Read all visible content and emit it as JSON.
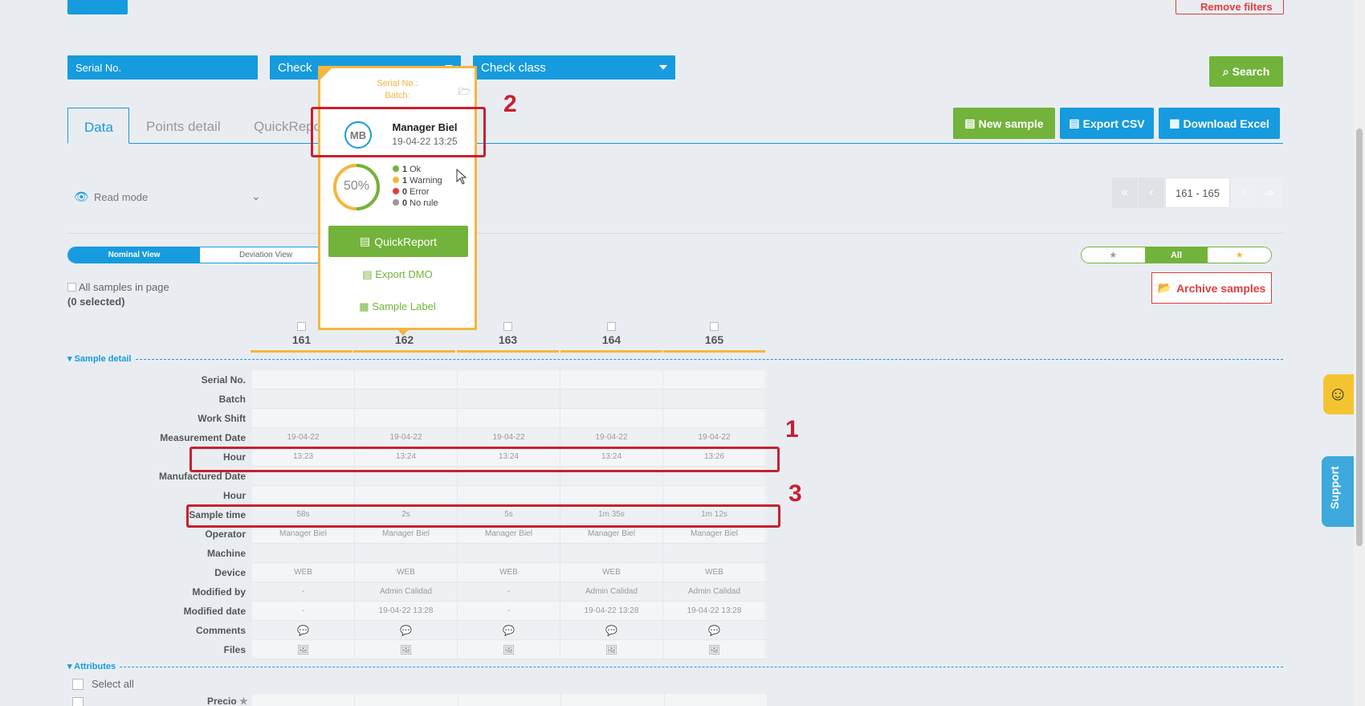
{
  "top": {
    "remove_filters": "Remove filters"
  },
  "filters": {
    "serial_no": "Serial No.",
    "check": "Check",
    "check_class": "Check class",
    "search": "Search"
  },
  "tabs": [
    {
      "label": "Data"
    },
    {
      "label": "Points detail"
    },
    {
      "label": "QuickRepo"
    }
  ],
  "actions": {
    "new_sample": "New sample",
    "export_csv": "Export CSV",
    "download_excel": "Download Excel"
  },
  "read_mode": "Read mode",
  "pager": {
    "range": "161 - 165"
  },
  "views": {
    "nominal": "Nominal View",
    "deviation": "Deviation View"
  },
  "star_filter": {
    "all": "All"
  },
  "all_samples": "All samples in page",
  "selected": "(0 selected)",
  "archive": "Archive samples",
  "columns": [
    "161",
    "162",
    "163",
    "164",
    "165"
  ],
  "sections": {
    "sample_detail": "Sample detail",
    "attributes": "Attributes"
  },
  "rows": [
    {
      "label": "Serial No.",
      "cells": [
        "",
        "",
        "",
        "",
        ""
      ]
    },
    {
      "label": "Batch",
      "cells": [
        "",
        "",
        "",
        "",
        ""
      ]
    },
    {
      "label": "Work Shift",
      "cells": [
        "",
        "",
        "",
        "",
        ""
      ]
    },
    {
      "label": "Measurement Date",
      "cells": [
        "19-04-22",
        "19-04-22",
        "19-04-22",
        "19-04-22",
        "19-04-22"
      ]
    },
    {
      "label": "Hour",
      "cells": [
        "13:23",
        "13:24",
        "13:24",
        "13:24",
        "13:26"
      ]
    },
    {
      "label": "Manufactured Date",
      "cells": [
        "",
        "",
        "",
        "",
        ""
      ]
    },
    {
      "label": "Hour",
      "cells": [
        "",
        "",
        "",
        "",
        ""
      ]
    },
    {
      "label": "Sample time",
      "cells": [
        "58s",
        "2s",
        "5s",
        "1m 35s",
        "1m 12s"
      ]
    },
    {
      "label": "Operator",
      "cells": [
        "Manager Biel",
        "Manager Biel",
        "Manager Biel",
        "Manager Biel",
        "Manager Biel"
      ]
    },
    {
      "label": "Machine",
      "cells": [
        "",
        "",
        "",
        "",
        ""
      ]
    },
    {
      "label": "Device",
      "cells": [
        "WEB",
        "WEB",
        "WEB",
        "WEB",
        "WEB"
      ]
    },
    {
      "label": "Modified by",
      "cells": [
        "-",
        "Admin Calidad",
        "-",
        "Admin Calidad",
        "Admin Calidad"
      ]
    },
    {
      "label": "Modified date",
      "cells": [
        "-",
        "19-04-22 13:28",
        "-",
        "19-04-22 13:28",
        "19-04-22 13:28"
      ]
    },
    {
      "label": "Comments",
      "cells": [
        "💬",
        "💬",
        "💬",
        "💬",
        "💬"
      ]
    },
    {
      "label": "Files",
      "cells": [
        "🖼",
        "🖼",
        "🖼",
        "🖼",
        "🖼"
      ]
    }
  ],
  "select_all": "Select all",
  "precio": "Precio",
  "popup": {
    "serial_label": "Serial No.:",
    "batch_label": "Batch:",
    "initials": "MB",
    "user": "Manager Biel",
    "datetime": "19-04-22 13:25",
    "percent": "50%",
    "percent_value": 50,
    "stats": [
      {
        "count": "1",
        "label": "Ok",
        "color": "#72b33b"
      },
      {
        "count": "1",
        "label": "Warning",
        "color": "#f4b63f"
      },
      {
        "count": "0",
        "label": "Error",
        "color": "#e23c3c"
      },
      {
        "count": "0",
        "label": "No rule",
        "color": "#999999"
      }
    ],
    "quickreport": "QuickReport",
    "export_dmo": "Export DMO",
    "sample_label": "Sample Label"
  },
  "annotations": {
    "n1": "1",
    "n2": "2",
    "n3": "3"
  },
  "support": "Support",
  "colors": {
    "primary": "#169bde",
    "success": "#72b33b",
    "warning": "#f4b63f",
    "danger": "#e23c3c",
    "annotation": "#c8202f"
  }
}
